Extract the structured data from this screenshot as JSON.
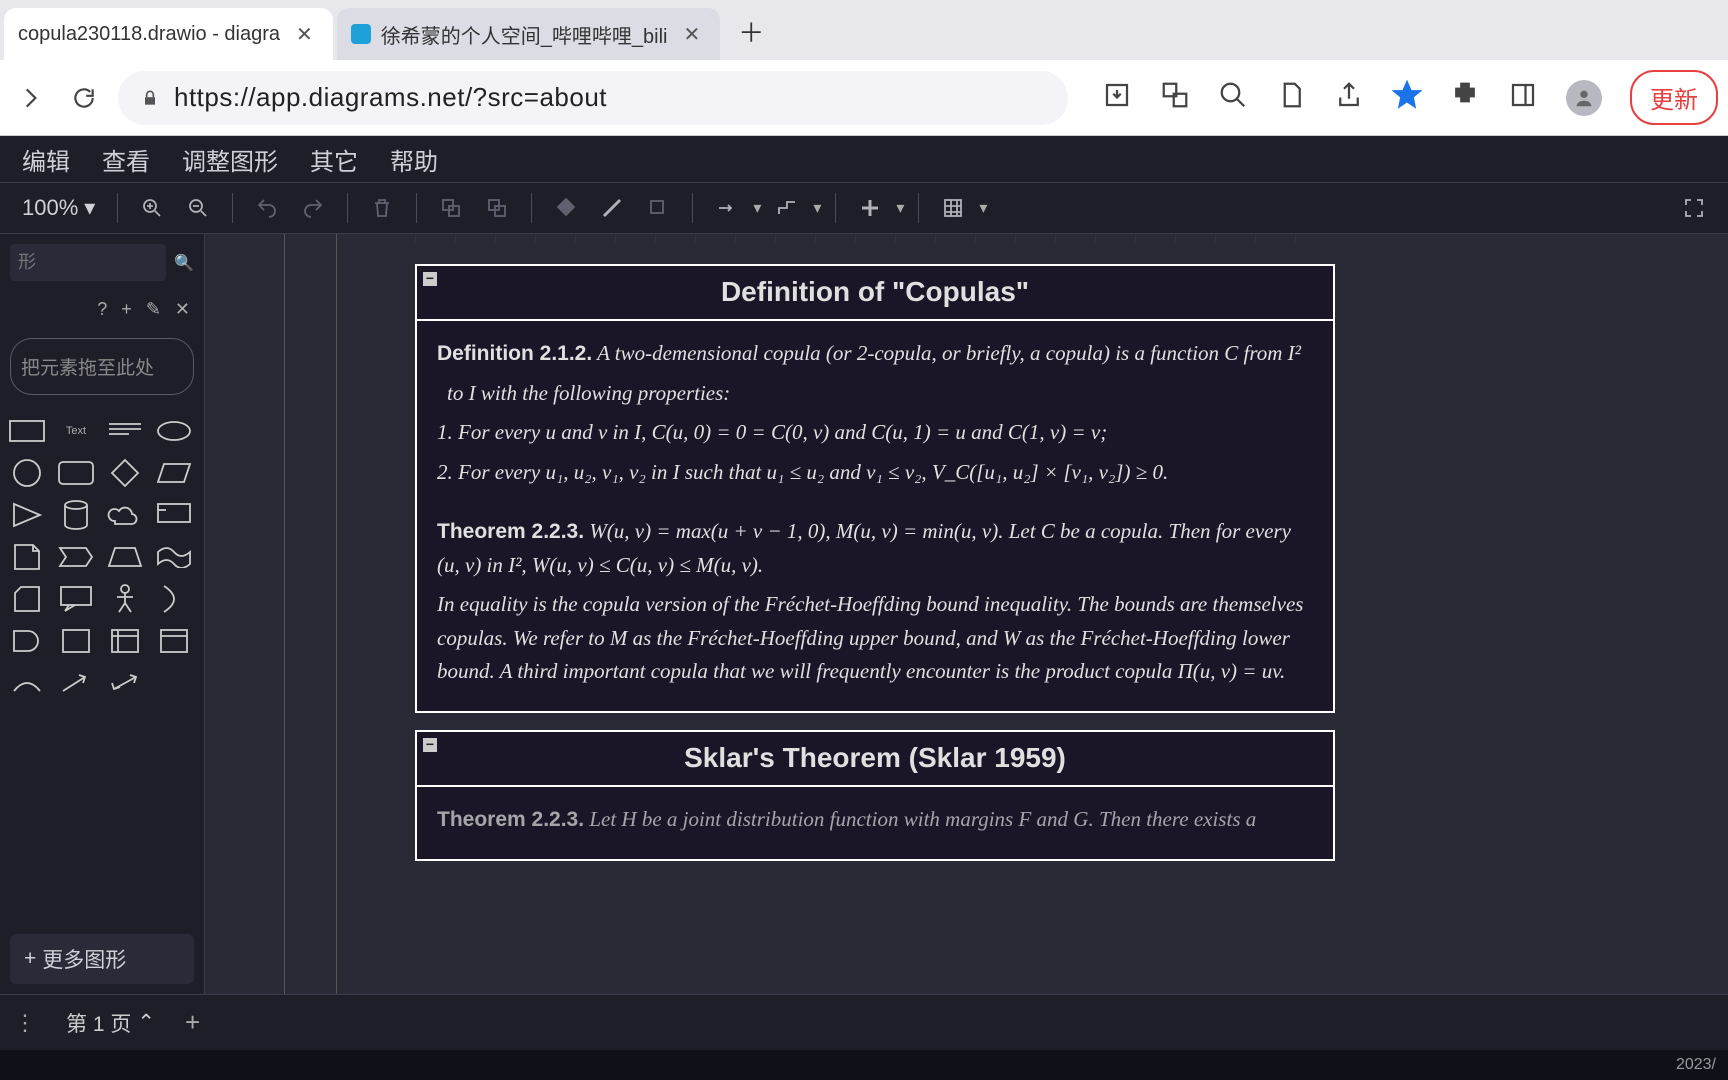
{
  "browser": {
    "tabs": [
      {
        "title": "copula230118.drawio - diagra"
      },
      {
        "title": "徐希蒙的个人空间_哔哩哔哩_bili"
      }
    ],
    "url": "https://app.diagrams.net/?src=about",
    "update_btn": "更新"
  },
  "menu": [
    "编辑",
    "查看",
    "调整图形",
    "其它",
    "帮助"
  ],
  "toolbar": {
    "zoom": "100%"
  },
  "sidebar": {
    "search_placeholder": "形",
    "drop_hint": "把元素拖至此处",
    "more_shapes": "更多图形"
  },
  "canvas": {
    "box1": {
      "title": "Definition of \"Copulas\"",
      "p1a": "Definition 2.1.2.",
      "p1b": " A two-demensional copula (or 2-copula, or briefly, a copula) is a function C from I²",
      "p1c": " to I with the following properties:",
      "p2": "1. For every u and v in I, C(u, 0) = 0 = C(0, v) and C(u, 1) = u and C(1, v) = v;",
      "p3": "2. For every u₁, u₂, v₁, v₂ in I such that u₁ ≤ u₂ and v₁ ≤ v₂, V_C([u₁, u₂] × [v₁, v₂]) ≥ 0.",
      "p4a": "Theorem 2.2.3.",
      "p4b": " W(u, v) = max(u + v − 1, 0), M(u, v) = min(u, v). Let C be a copula. Then for every (u, v) in I², W(u, v) ≤ C(u, v) ≤ M(u, v).",
      "p5": "In equality is the copula version of the Fréchet-Hoeffding bound inequality. The bounds are themselves copulas. We refer to M as the Fréchet-Hoeffding upper bound, and W as the Fréchet-Hoeffding lower bound. A third important copula that we will frequently encounter is the product copula Π(u, v) = uv."
    },
    "box2": {
      "title": "Sklar's Theorem (Sklar 1959)",
      "p1a": "Theorem 2.2.3.",
      "p1b": " Let H be a joint distribution function with margins F and G. Then there exists a"
    }
  },
  "pagebar": {
    "page_label": "第 1 页"
  },
  "status": {
    "date": "2023/"
  }
}
